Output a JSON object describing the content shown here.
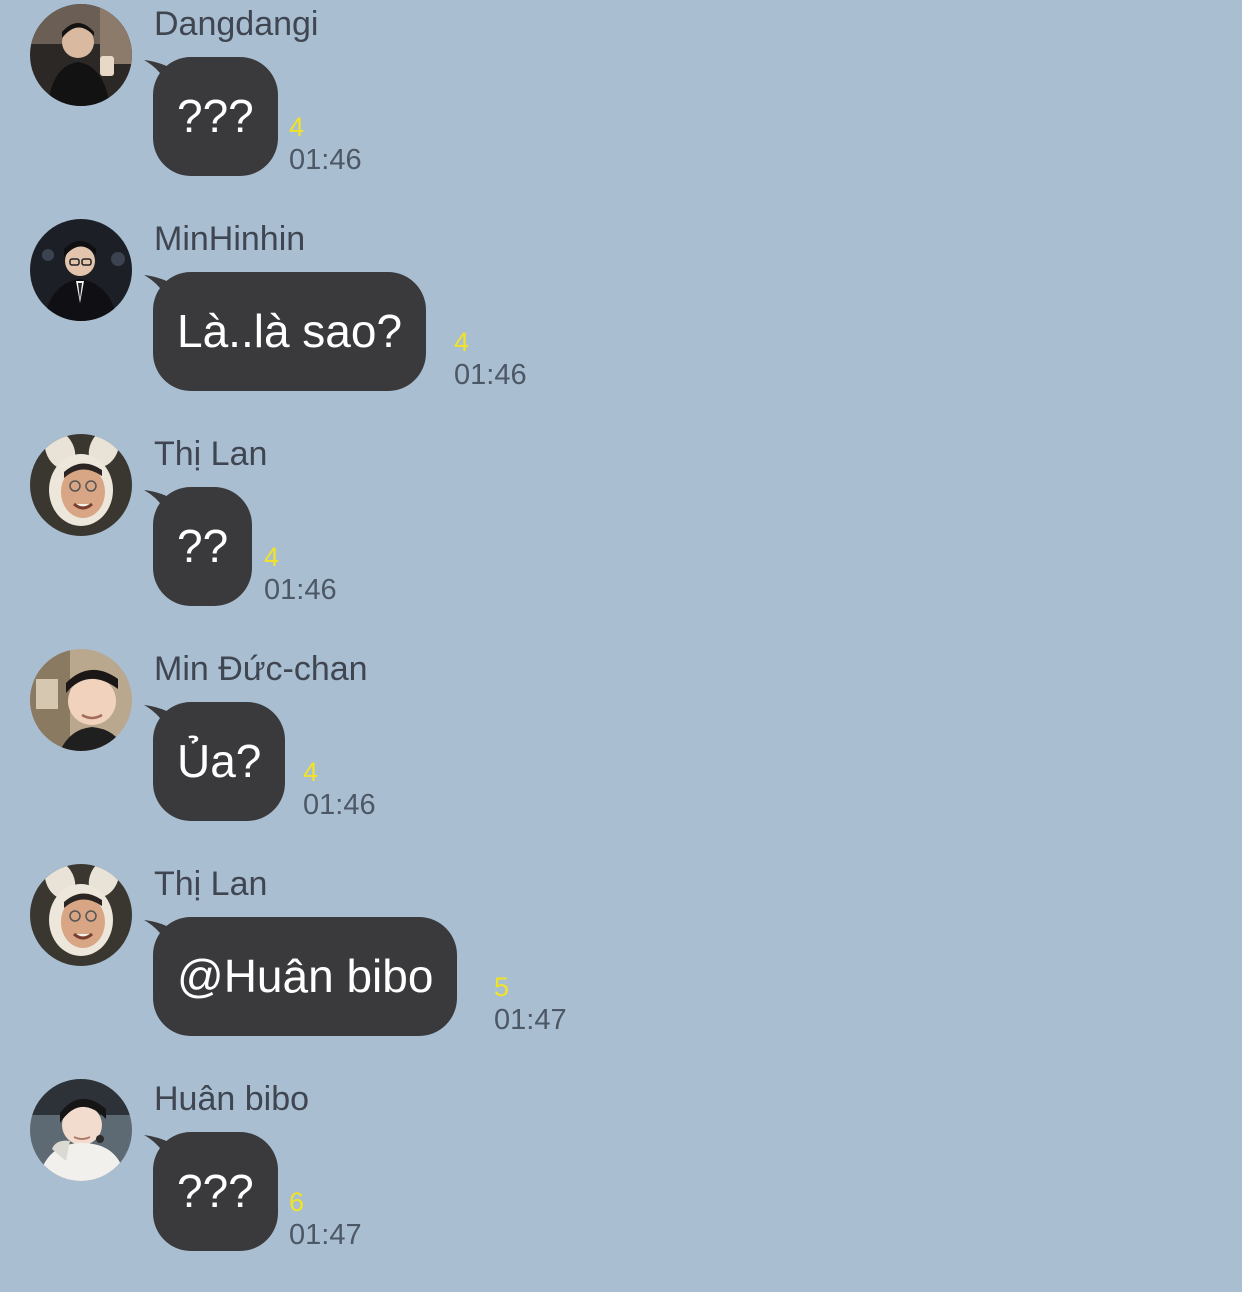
{
  "messages": [
    {
      "sender": "Dangdangi",
      "text": "???",
      "unread": "4",
      "time": "01:46",
      "avatar": "avatar-dark-shirt"
    },
    {
      "sender": "MinHinhin",
      "text": "Là..là sao?",
      "unread": "4",
      "time": "01:46",
      "avatar": "avatar-suit"
    },
    {
      "sender": "Thị Lan",
      "text": "??",
      "unread": "4",
      "time": "01:46",
      "avatar": "avatar-bunny-ears"
    },
    {
      "sender": "Min Đức-chan",
      "text": "Ủa?",
      "unread": "4",
      "time": "01:46",
      "avatar": "avatar-selfie"
    },
    {
      "sender": "Thị Lan",
      "text": "@Huân bibo",
      "unread": "5",
      "time": "01:47",
      "avatar": "avatar-bunny-ears"
    },
    {
      "sender": "Huân bibo",
      "text": "???",
      "unread": "6",
      "time": "01:47",
      "avatar": "avatar-white-hoodie"
    }
  ],
  "colors": {
    "background": "#a9bed0",
    "bubble": "#3a3a3d",
    "bubble_text": "#ffffff",
    "unread": "#f1e326",
    "time": "#4d5866",
    "sender": "#3f4652"
  }
}
